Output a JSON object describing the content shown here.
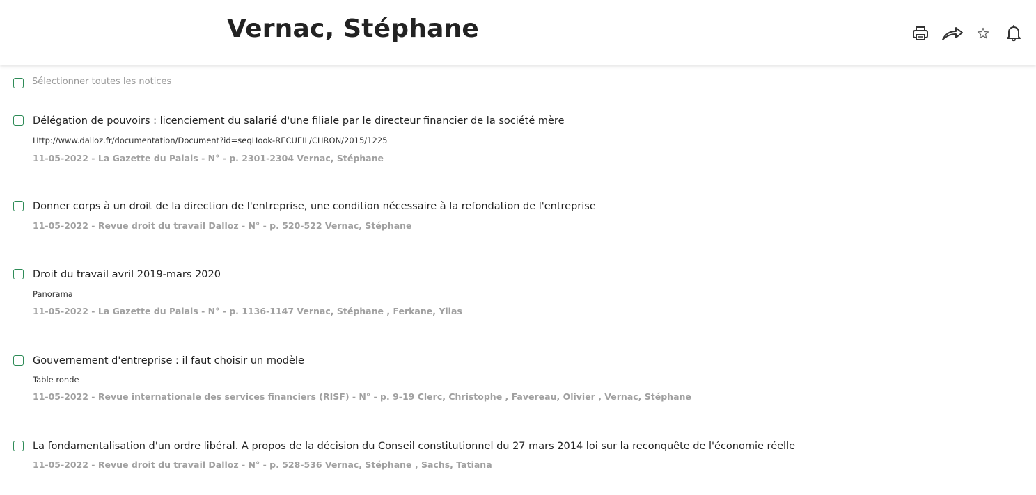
{
  "header": {
    "title": "Vernac, Stéphane",
    "actions": [
      {
        "icon": "printer-icon",
        "label": "print"
      },
      {
        "icon": "share-icon",
        "label": "share"
      },
      {
        "icon": "star-icon",
        "label": "favorite"
      },
      {
        "icon": "bell-icon",
        "label": "alert"
      }
    ]
  },
  "select_all": {
    "label": "Sélectionner toutes les notices"
  },
  "results": [
    {
      "title": "Délégation de pouvoirs : licenciement du salarié d'une filiale par le directeur financier de la société mère",
      "subtitle": "Http://www.dalloz.fr/documentation/Document?id=seqHook-RECUEIL/CHRON/2015/1225",
      "meta": "11-05-2022 - La Gazette du Palais - N° - p. 2301-2304 Vernac, Stéphane"
    },
    {
      "title": "Donner corps à un droit de la direction de l'entreprise, une condition nécessaire à la refondation de l'entreprise",
      "subtitle": "",
      "meta": "11-05-2022 - Revue droit du travail Dalloz - N° - p. 520-522 Vernac, Stéphane"
    },
    {
      "title": "Droit du travail avril 2019-mars 2020",
      "subtitle": "Panorama",
      "meta": "11-05-2022 - La Gazette du Palais - N° - p. 1136-1147 Vernac, Stéphane , Ferkane, Ylias"
    },
    {
      "title": "Gouvernement d'entreprise : il faut choisir un modèle",
      "subtitle": "Table ronde",
      "meta": "11-05-2022 - Revue internationale des services financiers (RISF) - N° - p. 9-19 Clerc, Christophe , Favereau, Olivier , Vernac, Stéphane"
    },
    {
      "title": "La fondamentalisation d'un ordre libéral. A propos de la décision du Conseil constitutionnel du 27 mars 2014 loi sur la reconquête de l'économie réelle",
      "subtitle": "",
      "meta": "11-05-2022 - Revue droit du travail Dalloz - N° - p. 528-536 Vernac, Stéphane , Sachs, Tatiana"
    }
  ]
}
